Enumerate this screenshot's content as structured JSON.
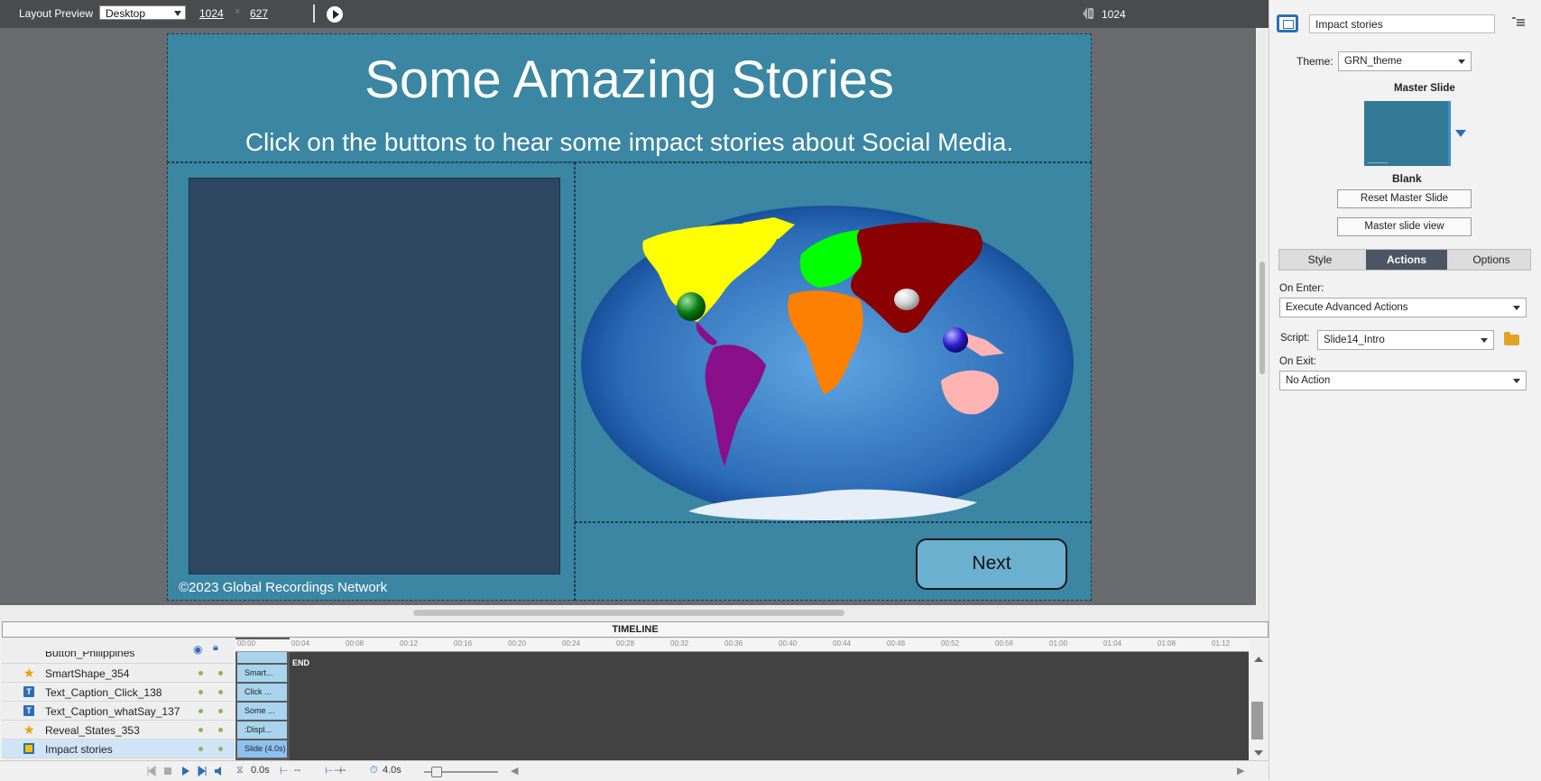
{
  "toolbar": {
    "layout_preview_label": "Layout Preview",
    "device": "Desktop",
    "width": "1024",
    "height": "627",
    "times_symbol": "×",
    "breakpoint_value": "1024"
  },
  "slide": {
    "title": "Some Amazing Stories",
    "subtitle": "Click on the buttons to hear some impact stories about Social Media.",
    "copyright": "©2023 Global Recordings Network",
    "next_button": "Next",
    "colors": {
      "background": "#3a86a3",
      "panel": "#2d4760",
      "button": "#6bb0cf"
    }
  },
  "properties": {
    "slide_name": "Impact stories",
    "theme_label": "Theme:",
    "theme_value": "GRN_theme",
    "master_slide_label": "Master Slide",
    "master_slide_name": "Blank",
    "reset_master_button": "Reset Master Slide",
    "master_view_button": "Master slide view",
    "tabs": [
      {
        "label": "Style",
        "active": false
      },
      {
        "label": "Actions",
        "active": true
      },
      {
        "label": "Options",
        "active": false
      }
    ],
    "on_enter_label": "On Enter:",
    "on_enter_value": "Execute Advanced Actions",
    "script_label": "Script:",
    "script_value": "Slide14_Intro",
    "on_exit_label": "On Exit:",
    "on_exit_value": "No Action"
  },
  "timeline": {
    "header": "TIMELINE",
    "rows": [
      {
        "name": "Button_Philippines",
        "block": ""
      },
      {
        "name": "SmartShape_354",
        "block": "Smart...",
        "icon": "star-icon"
      },
      {
        "name": "Text_Caption_Click_138",
        "block": "Click ...",
        "icon": "text-caption-icon"
      },
      {
        "name": "Text_Caption_whatSay_137",
        "block": "Some ...",
        "icon": "text-caption-icon"
      },
      {
        "name": "Reveal_States_353",
        "block": ":Displ...",
        "icon": "star-icon"
      },
      {
        "name": "Impact stories",
        "block": "Slide (4.0s)",
        "icon": "slide-icon"
      }
    ],
    "ruler_ticks": [
      "00:00",
      "00:04",
      "00:08",
      "00:12",
      "00:16",
      "00:20",
      "00:24",
      "00:28",
      "00:32",
      "00:36",
      "00:40",
      "00:44",
      "00:48",
      "00:52",
      "00:56",
      "01:00",
      "01:04",
      "01:08",
      "01:12"
    ],
    "end_label": "END",
    "footer": {
      "current_time": "0.0s",
      "start": "--",
      "duration_field": "--",
      "slide_duration": "4.0s"
    }
  }
}
